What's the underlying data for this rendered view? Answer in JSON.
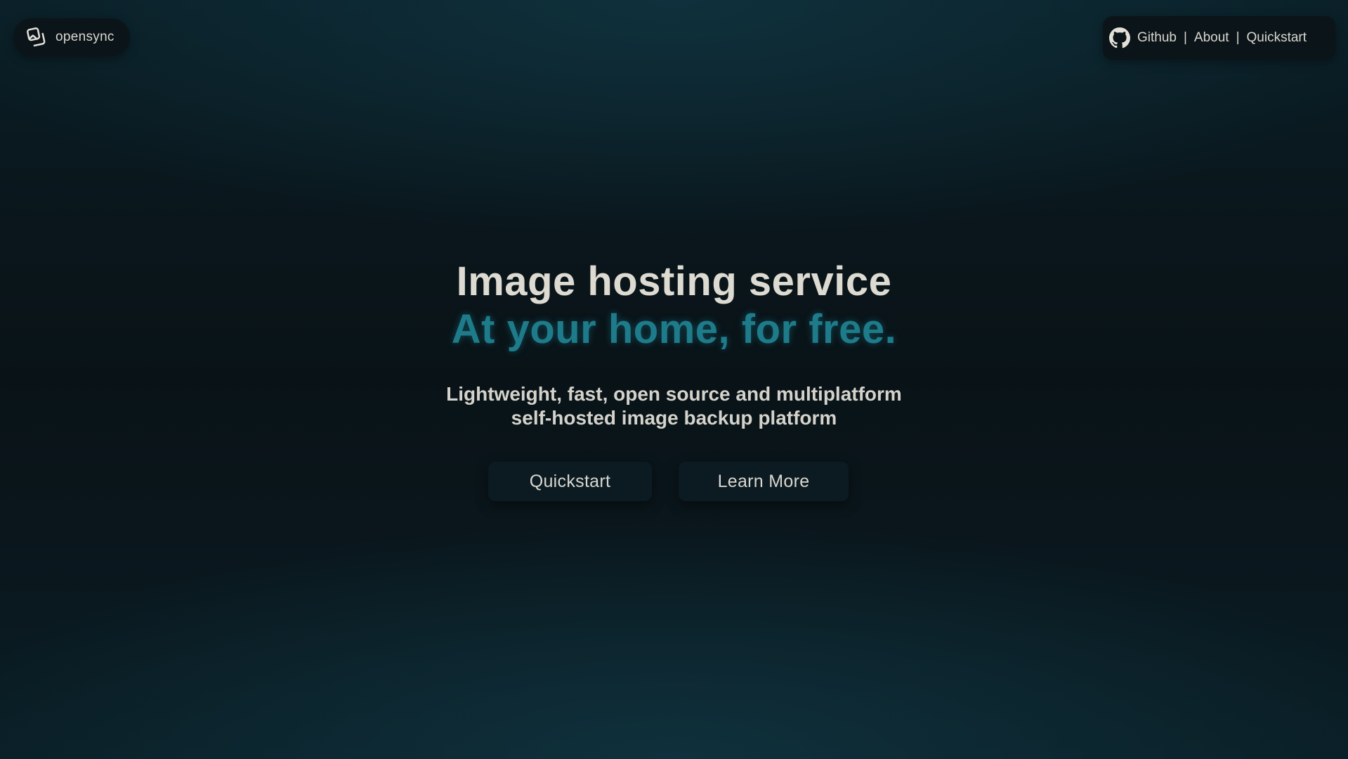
{
  "brand": {
    "name": "opensync",
    "icon": "images-icon"
  },
  "nav": {
    "icon": "github-icon",
    "links": [
      {
        "label": "Github"
      },
      {
        "label": "About"
      },
      {
        "label": "Quickstart"
      }
    ],
    "separator": "|"
  },
  "hero": {
    "title": "Image hosting service",
    "tagline": "At your home, for free.",
    "subtitle_line1": "Lightweight, fast, open source and multiplatform",
    "subtitle_line2": "self-hosted image backup platform"
  },
  "cta": {
    "primary_label": "Quickstart",
    "secondary_label": "Learn More"
  },
  "colors": {
    "background": "#0a161c",
    "accent": "#1e7b8a",
    "text": "#dcdad1",
    "pill": "#0b1418"
  }
}
